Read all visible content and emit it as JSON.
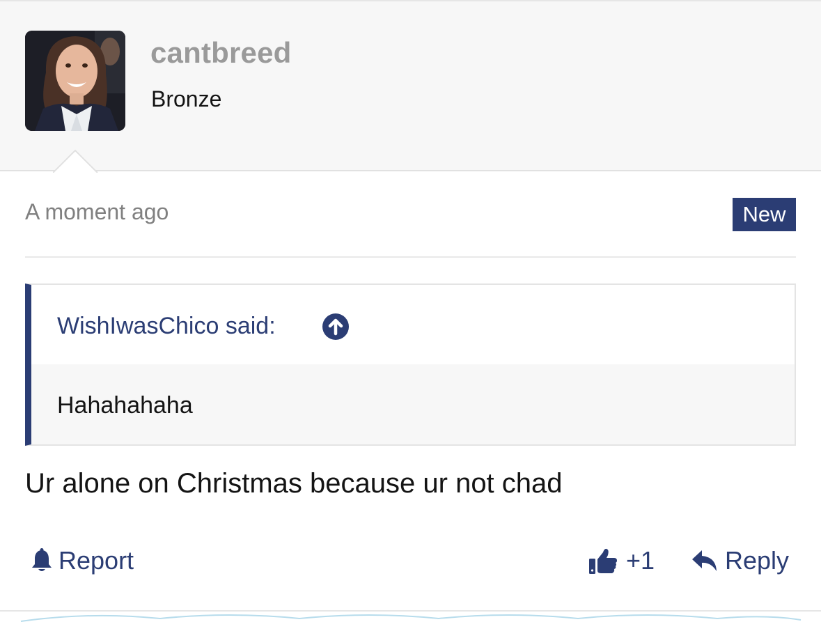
{
  "post": {
    "author": {
      "username": "cantbreed",
      "rank": "Bronze",
      "avatar": "avatar-photo"
    },
    "timestamp": "A moment ago",
    "badge": "New",
    "quote": {
      "attribution": "WishIwasChico said:",
      "goto_icon": "arrow-up-circle-icon",
      "text": "Hahahahaha"
    },
    "message": "Ur alone on Christmas because ur not chad"
  },
  "actions": {
    "report": {
      "label": "Report",
      "icon": "bell-icon"
    },
    "like": {
      "label": "+1",
      "icon": "thumbs-up-icon"
    },
    "reply": {
      "label": "Reply",
      "icon": "reply-arrow-icon"
    }
  },
  "colors": {
    "accent": "#2b3d74",
    "header_bg": "#f7f7f7",
    "username": "#9a9a9a",
    "timestamp": "#808080",
    "text": "#141414"
  }
}
